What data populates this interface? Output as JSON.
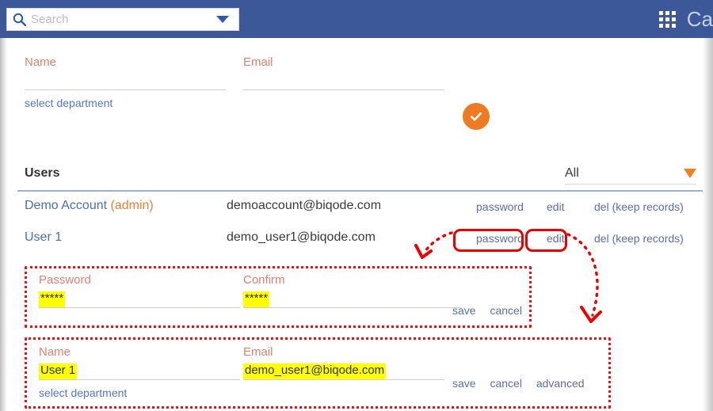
{
  "topbar": {
    "search_placeholder": "Search",
    "search_value": "",
    "search_icon": "search-icon",
    "dropdown_icon": "chevron-down-icon",
    "apps_icon": "grid-apps-icon",
    "brand_text": "Ca",
    "bg_color": "#3c5898"
  },
  "create_form": {
    "name_label": "Name",
    "name_value": "",
    "email_label": "Email",
    "email_value": "",
    "department_link": "select department",
    "confirm_icon": "check-circle-icon",
    "confirm_color": "#f07a21"
  },
  "users_section": {
    "title": "Users",
    "filter_value": "All",
    "filter_icon": "triangle-down-icon",
    "filter_color": "#f0811f",
    "rows": [
      {
        "name": "Demo Account",
        "role": "(admin)",
        "email": "demoaccount@biqode.com",
        "actions": [
          "password",
          "edit",
          "del (keep records)"
        ]
      },
      {
        "name": "User 1",
        "role": "",
        "email": "demo_user1@biqode.com",
        "actions": [
          "password",
          "edit",
          "del (keep records)"
        ]
      }
    ]
  },
  "password_panel": {
    "password_label": "Password",
    "password_value": "*****",
    "confirm_label": "Confirm",
    "confirm_value": "*****",
    "links": [
      "save",
      "cancel"
    ]
  },
  "edit_panel": {
    "name_label": "Name",
    "name_value": "User 1",
    "email_label": "Email",
    "email_value": "demo_user1@biqode.com",
    "department_link": "select department",
    "links": [
      "save",
      "cancel",
      "advanced"
    ]
  },
  "annotations": {
    "highlight_color": "#ffff00",
    "marker_color": "#ee0000"
  }
}
